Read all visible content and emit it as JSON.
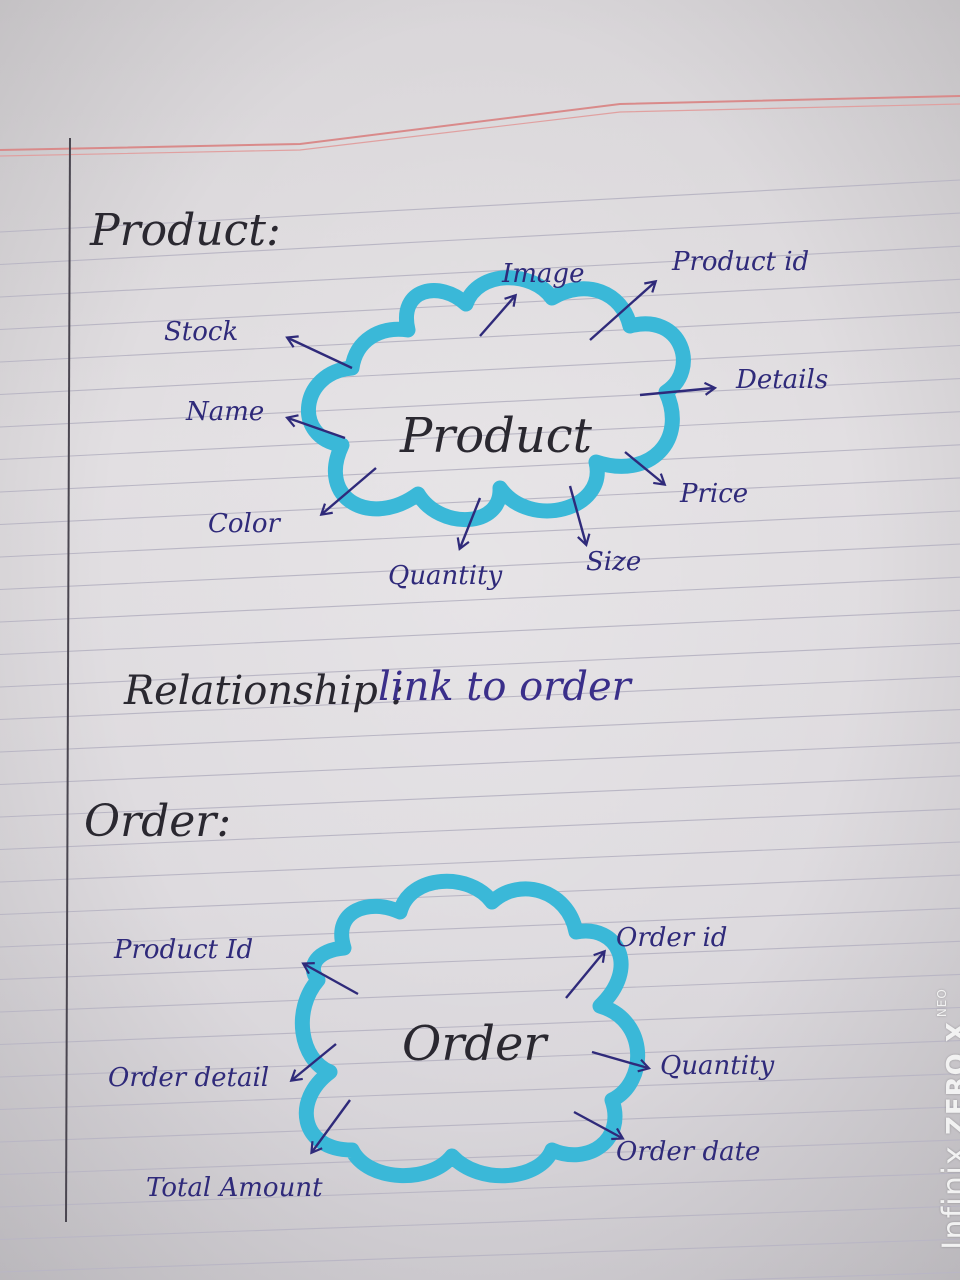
{
  "sections": {
    "product": {
      "heading": "Product:",
      "center": "Product",
      "attributes": {
        "image": "Image",
        "product_id": "Product id",
        "stock": "Stock",
        "details": "Details",
        "name": "Name",
        "price": "Price",
        "color": "Color",
        "quantity": "Quantity",
        "size": "Size"
      }
    },
    "relationship": {
      "label": "Relationship :",
      "value": "link to order"
    },
    "order": {
      "heading": "Order:",
      "center": "Order",
      "attributes": {
        "product_id": "Product Id",
        "order_id": "Order id",
        "order_detail": "Order detail",
        "quantity": "Quantity",
        "total_amount": "Total Amount",
        "order_date": "Order date"
      }
    }
  },
  "watermark": {
    "brand": "Infinix",
    "model": "ZERO X",
    "edition": "NEO"
  },
  "colors": {
    "cloud": "#3ab8d8",
    "ink_blue": "#2f2a7a",
    "ink_dark": "#2a2830",
    "margin_red": "#d98a8a",
    "rule_line": "#b9b6c4"
  }
}
